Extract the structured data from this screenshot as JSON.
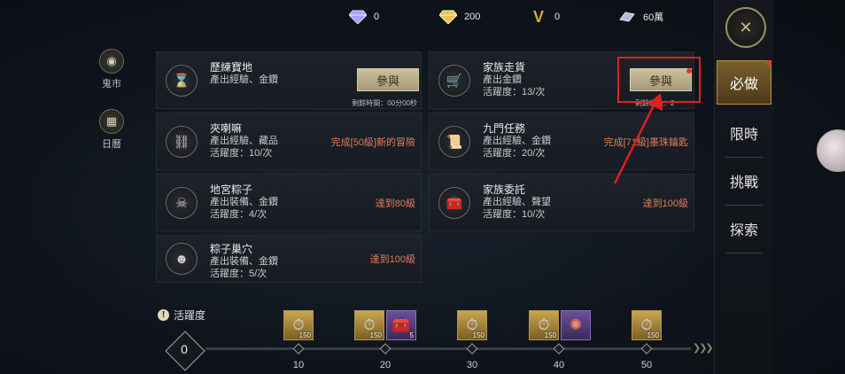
{
  "currencies": [
    {
      "icon": "diamond-icon",
      "value": "0"
    },
    {
      "icon": "gold-diamond-icon",
      "value": "200"
    },
    {
      "icon": "v-token-icon",
      "value": "0"
    },
    {
      "icon": "silver-ingot-icon",
      "value": "60萬"
    }
  ],
  "leftnav": [
    {
      "label": "鬼市",
      "icon": "ghost-market-icon"
    },
    {
      "label": "日曆",
      "icon": "calendar-icon"
    }
  ],
  "cards": {
    "lilian": {
      "title": "歷練寶地",
      "desc": "產出經驗、金鑽",
      "button": "參與",
      "sub": "剩餘時間：00分00秒"
    },
    "jiazu": {
      "title": "家族走貨",
      "desc": "產出金鑽",
      "activity": "活躍度：13/次",
      "button": "參與",
      "sub": "剩餘次數：2"
    },
    "jialama": {
      "title": "夾喇嘛",
      "desc": "產出經驗、藏品",
      "activity": "活躍度：10/次",
      "status": "完成[50級]新的冒險"
    },
    "jiumen": {
      "title": "九門任務",
      "desc": "產出經驗、金鑽",
      "activity": "活躍度：20/次",
      "status": "完成[71級]墨珠鑰匙"
    },
    "digong": {
      "title": "地宮粽子",
      "desc": "產出裝備、金鑽",
      "activity": "活躍度：4/次",
      "status": "達到80級"
    },
    "weituo": {
      "title": "家族委託",
      "desc": "產出經驗、聲望",
      "activity": "活躍度：10/次",
      "status": "達到100級"
    },
    "chaoxue": {
      "title": "粽子巢穴",
      "desc": "產出裝備、金鑽",
      "activity": "活躍度：5/次",
      "status": "達到100級"
    }
  },
  "tabs": [
    "必做",
    "限時",
    "挑戰",
    "探索"
  ],
  "activity_bar": {
    "label": "活躍度",
    "current": "0",
    "progress": 0,
    "milestones": [
      "10",
      "20",
      "30",
      "40",
      "50"
    ],
    "rewards": [
      {
        "icon": "pocket-watch-icon",
        "count": "150"
      },
      {
        "icon": "pocket-watch-icon",
        "count": "150"
      },
      {
        "icon": "treasure-chest-icon",
        "count": "5"
      },
      {
        "icon": "pocket-watch-icon",
        "count": "150"
      },
      {
        "icon": "pocket-watch-icon",
        "count": "150"
      },
      {
        "icon": "medal-icon",
        "count": ""
      },
      {
        "icon": "pocket-watch-icon",
        "count": "150"
      }
    ]
  },
  "colors": {
    "status_red": "#e07b5a",
    "gold": "#b58f48",
    "highlight": "#e02020"
  }
}
